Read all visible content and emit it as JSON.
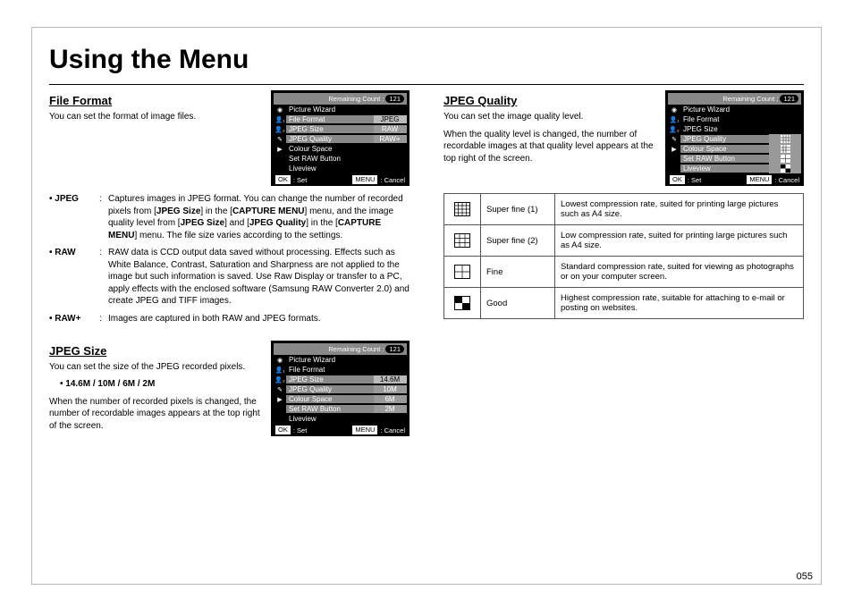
{
  "page_title": "Using the Menu",
  "page_number": "055",
  "left": {
    "file_format": {
      "heading": "File Format",
      "intro": "You can set the format of image files.",
      "defs": [
        {
          "term": "• JPEG",
          "desc_html": "Captures images in JPEG format. You can change the number of recorded pixels from [<b>JPEG Size</b>] in the [<b>CAPTURE MENU</b>] menu, and the image quality level from [<b>JPEG Size</b>] and [<b>JPEG Quality</b>] in the [<b>CAPTURE MENU</b>] menu. The file size varies according to the settings."
        },
        {
          "term": "• RAW",
          "desc_html": "RAW data is CCD output data saved without processing. Effects such as White Balance, Contrast, Saturation and Sharpness are not applied to the image but such information is saved. Use Raw Display or transfer to a PC, apply effects with the enclosed software (Samsung RAW Converter 2.0) and create JPEG and TIFF images."
        },
        {
          "term": "• RAW+",
          "desc_html": "Images are captured in both RAW and JPEG formats."
        }
      ]
    },
    "jpeg_size": {
      "heading": "JPEG Size",
      "intro": "You can set the size of the JPEG recorded pixels.",
      "sizes": "• 14.6M / 10M / 6M / 2M",
      "note": "When the number of recorded pixels is changed, the number of recordable images appears at the top right of the screen."
    }
  },
  "right": {
    "jpeg_quality": {
      "heading": "JPEG Quality",
      "intro": "You can set the image quality level.",
      "note": "When the quality level is changed, the number of recordable images at that quality level appears at the top right of the screen."
    },
    "quality_rows": [
      {
        "name": "Super fine (1)",
        "desc": "Lowest compression rate, suited for printing large pictures such as A4 size.",
        "icon": "sf1"
      },
      {
        "name": "Super fine (2)",
        "desc": "Low compression rate, suited for printing large pictures such as A4 size.",
        "icon": "sf2"
      },
      {
        "name": "Fine",
        "desc": "Standard compression rate, suited for viewing as photographs or on your computer screen.",
        "icon": "fine"
      },
      {
        "name": "Good",
        "desc": "Highest compression rate, suitable for attaching to e-mail or posting on websites.",
        "icon": "good"
      }
    ]
  },
  "lcd": {
    "remaining_label": "Remaining Count :",
    "remaining_count": "121",
    "set": "Set",
    "cancel": "Cancel",
    "ok": "OK",
    "menu": "MENU",
    "items": [
      "Picture Wizard",
      "File Format",
      "JPEG Size",
      "JPEG Quality",
      "Colour Space",
      "Set RAW Button",
      "Liveview"
    ],
    "file_format_vals": [
      "JPEG",
      "RAW",
      "RAW+"
    ],
    "size_vals": [
      "14.6M",
      "10M",
      "6M",
      "2M"
    ]
  }
}
